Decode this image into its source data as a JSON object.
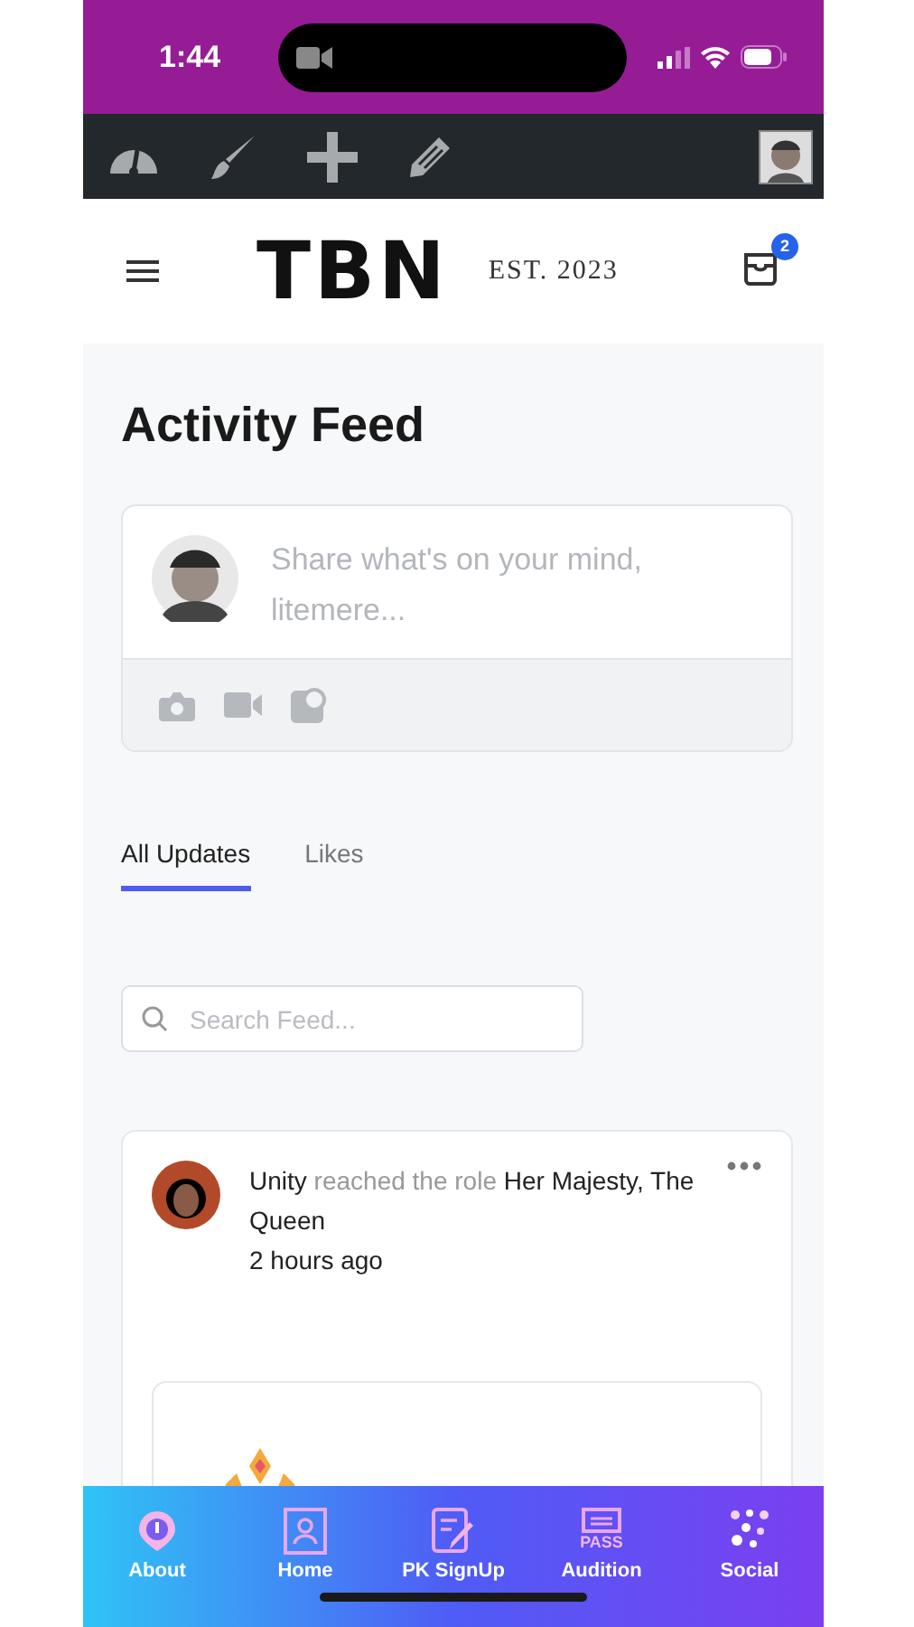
{
  "status_bar": {
    "time": "1:44"
  },
  "admin_bar": {
    "tools": [
      {
        "kind": "gauge"
      },
      {
        "kind": "brush"
      },
      {
        "kind": "plus"
      },
      {
        "kind": "pencil"
      }
    ]
  },
  "header": {
    "logo": "TBN",
    "tagline": "EST. 2023",
    "cart_badge": "2"
  },
  "page_title": "Activity Feed",
  "composer": {
    "placeholder": "Share what's on your mind, litemere...",
    "tools": [
      {
        "kind": "camera"
      },
      {
        "kind": "video"
      },
      {
        "kind": "gif"
      }
    ]
  },
  "tabs": [
    {
      "label": "All Updates",
      "selected": true
    },
    {
      "label": "Likes",
      "selected": false
    }
  ],
  "search": {
    "placeholder": "Search Feed..."
  },
  "feed": [
    {
      "text": "**Unity** reached the role **Her Majesty, The Queen**",
      "time": "2 hours ago"
    }
  ],
  "bottom_nav": [
    {
      "label": "About",
      "kind": "info"
    },
    {
      "label": "Home",
      "kind": "home"
    },
    {
      "label": "PK SignUp",
      "kind": "signup"
    },
    {
      "label": "Audition",
      "kind": "pass",
      "icon_text": "PASS"
    },
    {
      "label": "Social",
      "kind": "dots"
    }
  ]
}
